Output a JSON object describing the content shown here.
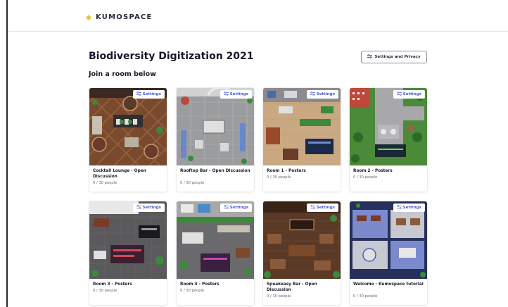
{
  "app": {
    "logo_text": "KUMOSPACE",
    "logo_color": "#f2c230"
  },
  "page": {
    "title": "Biodiversity Digitization 2021",
    "subtitle": "Join a room below",
    "settings_privacy_label": "Settings and Privacy"
  },
  "accent_color": "#4a5ccc",
  "rooms": [
    {
      "name": "Cocktail Lounge - Open Discussion",
      "count": "0 / 30 people",
      "settings_label": "Settings",
      "theme": "lounge"
    },
    {
      "name": "Rooftop Bar - Open Discussion",
      "count": "0 / 30 people",
      "settings_label": "Settings",
      "theme": "rooftop"
    },
    {
      "name": "Room 1 - Posters",
      "count": "0 / 30 people",
      "settings_label": "Settings",
      "theme": "posters1"
    },
    {
      "name": "Room 2 - Posters",
      "count": "0 / 30 people",
      "settings_label": "Settings",
      "theme": "garden"
    },
    {
      "name": "Room 3 - Posters",
      "count": "0 / 30 people",
      "settings_label": "Settings",
      "theme": "posters3"
    },
    {
      "name": "Room 4 - Posters",
      "count": "0 / 30 people",
      "settings_label": "Settings",
      "theme": "posters4"
    },
    {
      "name": "Speakeasy Bar - Open Discussion",
      "count": "0 / 30 people",
      "settings_label": "Settings",
      "theme": "speakeasy"
    },
    {
      "name": "Welcome - Kumospace tutorial",
      "count": "0 / 30 people",
      "settings_label": "Settings",
      "theme": "welcome"
    }
  ]
}
